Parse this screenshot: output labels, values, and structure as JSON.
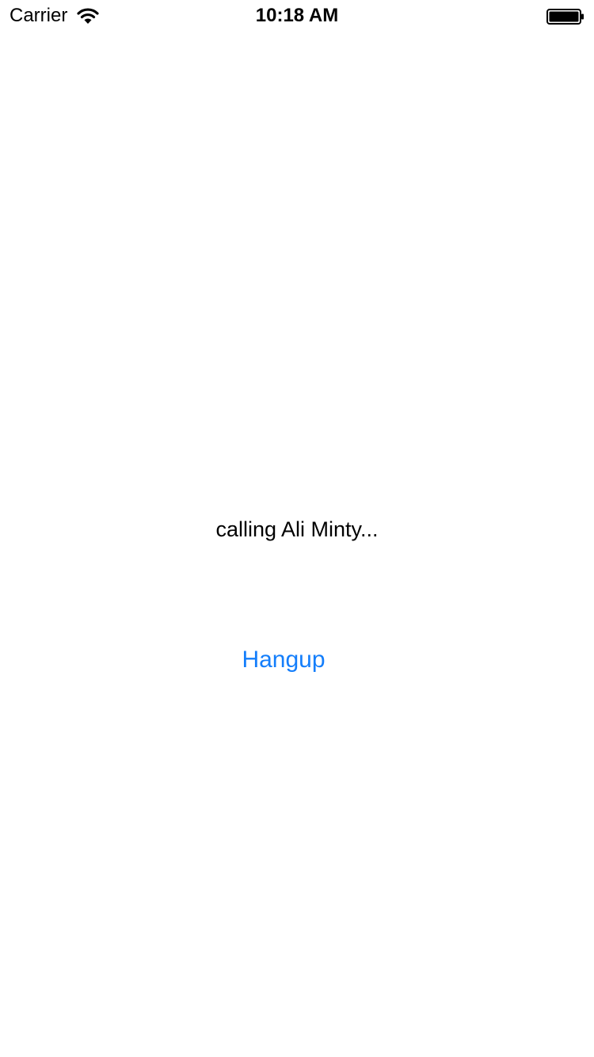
{
  "status_bar": {
    "carrier": "Carrier",
    "time": "10:18 AM",
    "wifi_icon": "wifi-icon",
    "battery_icon": "battery-full-icon",
    "battery_level": 1.0
  },
  "call": {
    "status_text": "calling Ali Minty...",
    "hangup_label": "Hangup"
  },
  "colors": {
    "accent": "#147EFB",
    "background": "#FFFFFF",
    "text": "#000000"
  }
}
